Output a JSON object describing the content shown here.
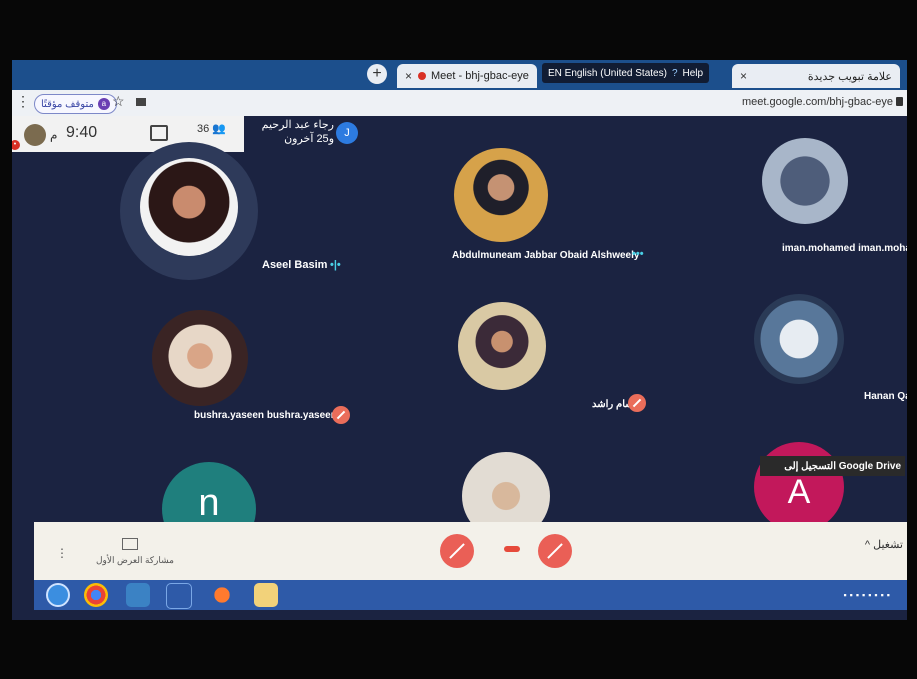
{
  "browser": {
    "tab_active_title": "Meet - bhj-gbac-eye",
    "tab_other_title": "علامة تبويب جديدة",
    "new_tab_symbol": "+",
    "close_symbol": "×",
    "language_indicator": "EN English (United States)",
    "help_label": "Help",
    "profile_label": "متوقف مؤقتًا",
    "url": "meet.google.com/bhj-gbac-eye"
  },
  "meeting_info": {
    "time": "9:40",
    "ampm": "م",
    "participant_count": "36",
    "presenter_name": "رجاء عبد الرحيم",
    "presenter_others": "و25 آخرون",
    "presenter_initial": "J"
  },
  "participants": [
    {
      "name": "Aseel Basim",
      "status": "speaking"
    },
    {
      "name": "Abdulmuneam Jabbar Obaid Alshweely",
      "status": "more"
    },
    {
      "name": "iman.mohamed iman.mohar",
      "status": "none"
    },
    {
      "name": "bushra.yaseen bushra.yaseen",
      "status": "muted"
    },
    {
      "name": "ابتسام راشد",
      "status": "muted"
    },
    {
      "name": "Hanan Qa",
      "status": "none"
    },
    {
      "name": "",
      "status": "none",
      "initial": "n"
    },
    {
      "name": "",
      "status": "none"
    },
    {
      "name": "",
      "status": "none",
      "initial": "A"
    }
  ],
  "toast": {
    "text": "التسجيل إلى Google Drive"
  },
  "controls": {
    "present_label": "مشاركة العرض الأول",
    "captions_label": "تشغيل"
  },
  "colors": {
    "meet_background": "#1b2341",
    "mute_red": "#ea5f56",
    "speaking_cyan": "#49d0e6",
    "tab_bar": "#1c4f8c"
  }
}
